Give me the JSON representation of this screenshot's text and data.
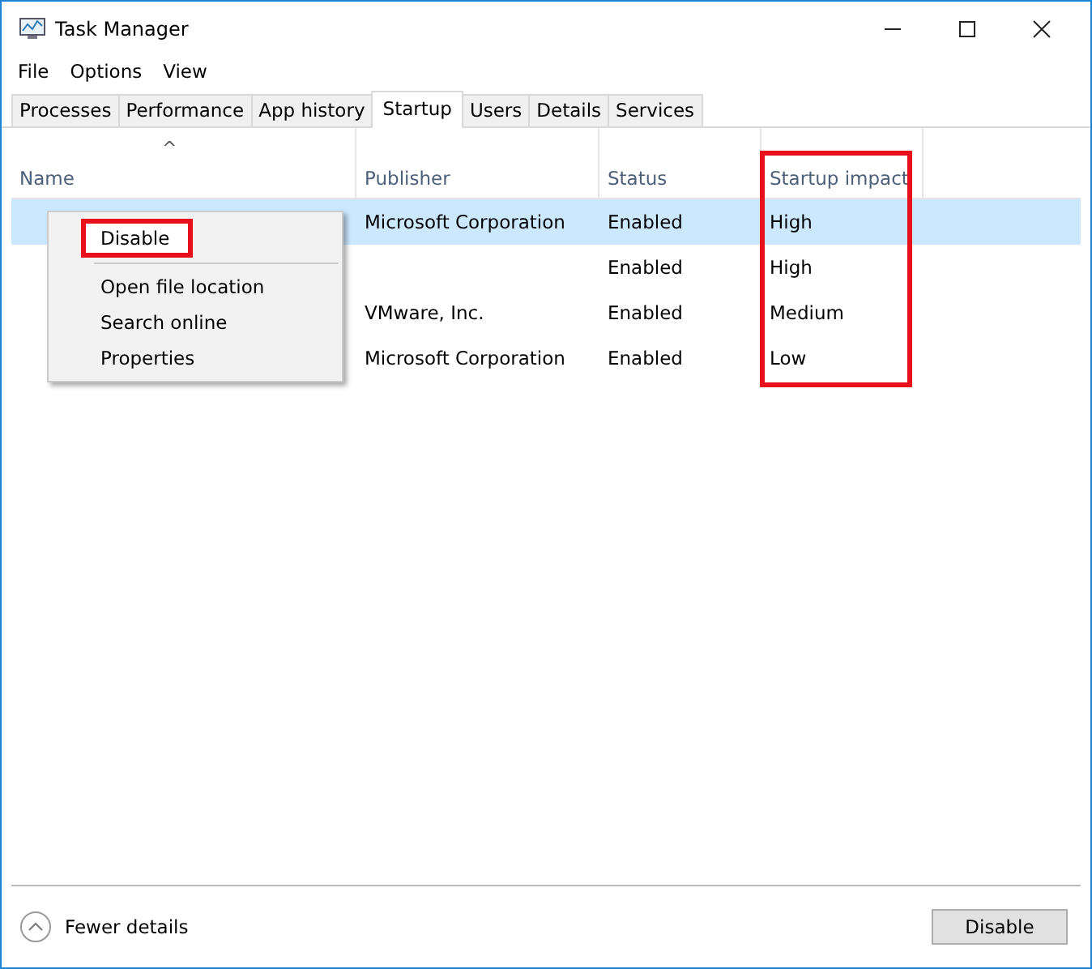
{
  "window": {
    "title": "Task Manager"
  },
  "menu_bar": [
    "File",
    "Options",
    "View"
  ],
  "tabs": [
    {
      "label": "Processes",
      "selected": false
    },
    {
      "label": "Performance",
      "selected": false
    },
    {
      "label": "App history",
      "selected": false
    },
    {
      "label": "Startup",
      "selected": true
    },
    {
      "label": "Users",
      "selected": false
    },
    {
      "label": "Details",
      "selected": false
    },
    {
      "label": "Services",
      "selected": false
    }
  ],
  "table": {
    "sort_indicator": "^",
    "columns": [
      {
        "label": "Name",
        "highlighted": false
      },
      {
        "label": "Publisher",
        "highlighted": false
      },
      {
        "label": "Status",
        "highlighted": false
      },
      {
        "label": "Startup impact",
        "highlighted": true
      }
    ],
    "rows": [
      {
        "selected": true,
        "cells": [
          "",
          "Microsoft Corporation",
          "Enabled",
          "High"
        ]
      },
      {
        "selected": false,
        "cells": [
          "",
          "",
          "Enabled",
          "High"
        ]
      },
      {
        "selected": false,
        "cells": [
          "",
          "VMware, Inc.",
          "Enabled",
          "Medium"
        ]
      },
      {
        "selected": false,
        "cells": [
          "",
          "Microsoft Corporation",
          "Enabled",
          "Low"
        ]
      }
    ]
  },
  "context_menu": [
    {
      "label": "Disable",
      "highlighted": true,
      "separator_after": true
    },
    {
      "label": "Open file location",
      "highlighted": false,
      "separator_after": false
    },
    {
      "label": "Search online",
      "highlighted": false,
      "separator_after": false
    },
    {
      "label": "Properties",
      "highlighted": false,
      "separator_after": false
    }
  ],
  "footer": {
    "toggle_label": "Fewer details",
    "button": "Disable"
  }
}
